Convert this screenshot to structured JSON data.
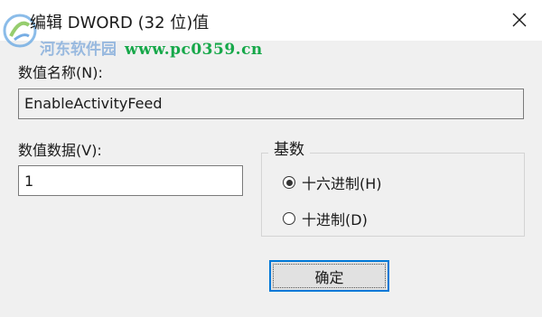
{
  "dialog": {
    "title": "编辑 DWORD (32 位)值",
    "close_icon": "close-icon"
  },
  "watermark": {
    "site": "www.pc0359.cn",
    "cn_text": "河东软件园",
    "color": "#17a84a"
  },
  "value_name": {
    "label": "数值名称(N):",
    "value": "EnableActivityFeed"
  },
  "value_data": {
    "label": "数值数据(V):",
    "value": "1"
  },
  "base": {
    "label": "基数",
    "options": [
      {
        "label": "十六进制(H)",
        "selected": true
      },
      {
        "label": "十进制(D)",
        "selected": false
      }
    ]
  },
  "buttons": {
    "ok_label": "确定"
  },
  "colors": {
    "accent": "#0078d7",
    "background": "#f0f0f0"
  }
}
